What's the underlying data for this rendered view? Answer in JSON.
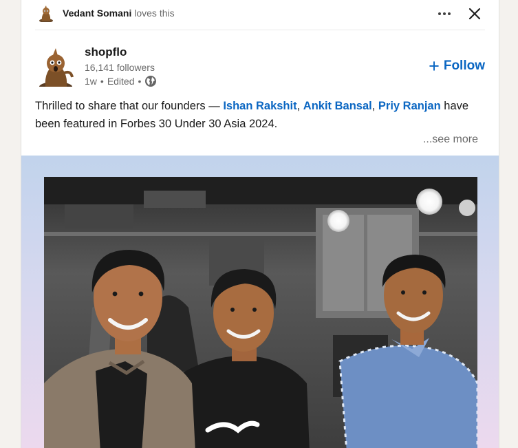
{
  "social": {
    "actor_name": "Vedant Somani",
    "verb": "loves this",
    "more_icon": "ellipsis-icon",
    "close_icon": "close-icon"
  },
  "actor": {
    "name": "shopflo",
    "followers": "16,141 followers",
    "time": "1w",
    "sep1": "•",
    "edited": "Edited",
    "sep2": "•",
    "visibility_icon": "globe-icon"
  },
  "follow": {
    "plus": "+",
    "label": "Follow"
  },
  "commentary": {
    "before": "Thrilled to share that our founders — ",
    "mention1": "Ishan Rakshit",
    "comma1": ", ",
    "mention2": "Ankit Bansal",
    "comma2": ", ",
    "mention3": "Priy Ranjan",
    "after": " have been featured in Forbes 30 Under 30 Asia 2024."
  },
  "see_more": "...see more",
  "colors": {
    "link": "#0a66c2",
    "card": "#ffffff",
    "page_bg": "#f4f2ee"
  }
}
